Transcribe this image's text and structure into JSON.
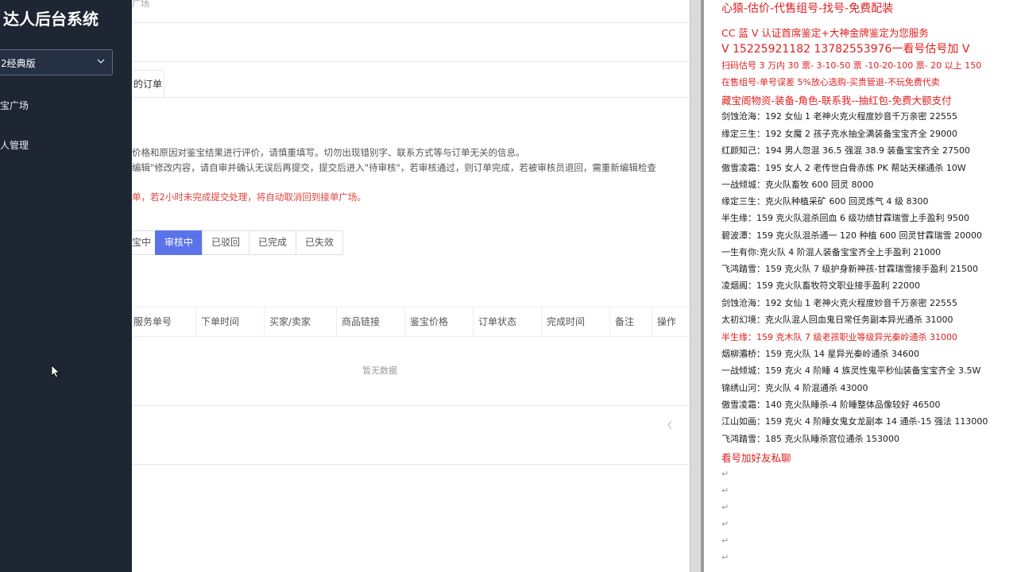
{
  "sidebar": {
    "title": "达人后台系统",
    "edition_select": "2经典版",
    "items": [
      "宝广场",
      "人管理"
    ]
  },
  "main": {
    "breadcrumb_fragment": "广场",
    "tab_label": "的订单",
    "notices": [
      "价格和原因对鉴宝结果进行评价，请慎重填写。切勿出现错别字、联系方式等与订单无关的信息。",
      "编辑\"修改内容，请自审并确认无误后再提交，提交后进入\"待审核\"，若审核通过，则订单完成，若被审核员退回，需重新编辑检查",
      "单，若2小时未完成提交处理，将自动取消回到接单广场。"
    ],
    "status_tabs": [
      "宝中",
      "审核中",
      "已驳回",
      "已完成",
      "已失效"
    ],
    "active_status": "审核中",
    "columns": [
      "服务单号",
      "下单时间",
      "买家/卖家",
      "商品链接",
      "鉴宝价格",
      "订单状态",
      "完成时间",
      "备注",
      "操作"
    ],
    "empty_text": "暂无数据"
  },
  "doc": {
    "lines": [
      {
        "text": "心猿-估价-代售组号-找号-免费配装",
        "style": "red big"
      },
      {
        "text": "CC 蓝 V 认证首席鉴定+大神金牌鉴定为您服务",
        "style": "red mid"
      },
      {
        "text": "V 15225921182     13782553976一看号估号加 V",
        "style": "red big"
      },
      {
        "text": "扫码估号 3 万内 30 票- 3-10-50 票  -10-20-100 票- 20 以上 150",
        "style": "red"
      },
      {
        "text": "在售组号-单号误差 5%放心选购-买贵管退-不玩免费代卖",
        "style": "red"
      },
      {
        "text": "藏宝阁物资-装备-角色-联系我--抽红包-免费大额支付",
        "style": "red mid"
      },
      {
        "text": "剑蚀沧海：192 女仙 1 老神火克火程度妙音千万亲密 22555",
        "style": ""
      },
      {
        "text": "缘定三生：192 女魔 2 孩子克水抽全满装备宝宝齐全 29000",
        "style": ""
      },
      {
        "text": "红颜知己：194 男人忽混 36.5 强混 38.9 装备宝宝齐全 27500",
        "style": ""
      },
      {
        "text": "傲雪凌霜：195 女人 2 老传世白骨赤炼 PK 帮站天梯通杀 10W",
        "style": ""
      },
      {
        "text": "一战倾城：克火队畜牧 600 回灵 8000",
        "style": ""
      },
      {
        "text": "缘定三生：克火队种植采矿 600 回灵炼气 4 级 8300",
        "style": ""
      },
      {
        "text": "半生缘：159 克火队混杀回血 6 级功绩甘霖瑞雪上手盈利 9500",
        "style": ""
      },
      {
        "text": "碧波潭：159 克火队混杀通一 120 种植 600 回灵甘霖瑞雪 20000",
        "style": ""
      },
      {
        "text": "一生有你:克火队 4 阶混人装备宝宝齐全上手盈利 21000",
        "style": ""
      },
      {
        "text": "飞鸿踏雪：159 克火队 7 级护身新神孩-甘霖瑞雪接手盈利 21500",
        "style": ""
      },
      {
        "text": "凌烟阁：159 克火队畜牧符文职业接手盈利 22000",
        "style": ""
      },
      {
        "text": "剑蚀沧海：192 女仙 1 老神火克火程度妙音千万亲密 22555",
        "style": ""
      },
      {
        "text": "太初幻境：克火队混人回血鬼日常任务副本异光通杀 31000",
        "style": ""
      },
      {
        "text": "半生缘：159 克木队 7 级老孩职业等级异光秦岭通杀 31000",
        "style": "red"
      },
      {
        "text": "烟柳灞桥：159 克火队 14 星异光秦岭通杀 34600",
        "style": ""
      },
      {
        "text": "一战倾城：159 克火 4 阶睡 4 族灵性鬼平秒仙装备宝宝齐全 3.5W",
        "style": ""
      },
      {
        "text": "锦绣山河：克火队 4 阶混通杀 43000",
        "style": ""
      },
      {
        "text": "傲雪凌霜：140 克火队睡杀-4 阶睡整体品像较好 46500",
        "style": ""
      },
      {
        "text": "江山如画：159 克火 4 阶睡女鬼女龙副本 14 通杀-15 强法 113000",
        "style": ""
      },
      {
        "text": "飞鸿踏雪：185 克火队睡杀宫位通杀 153000",
        "style": ""
      },
      {
        "text": "看号加好友私聊",
        "style": "red mid"
      }
    ],
    "empty_paragraph_count": 6
  },
  "colors": {
    "sidebar_bg": "#1f2633",
    "accent": "#5b73e8",
    "doc_red": "#e02020"
  }
}
